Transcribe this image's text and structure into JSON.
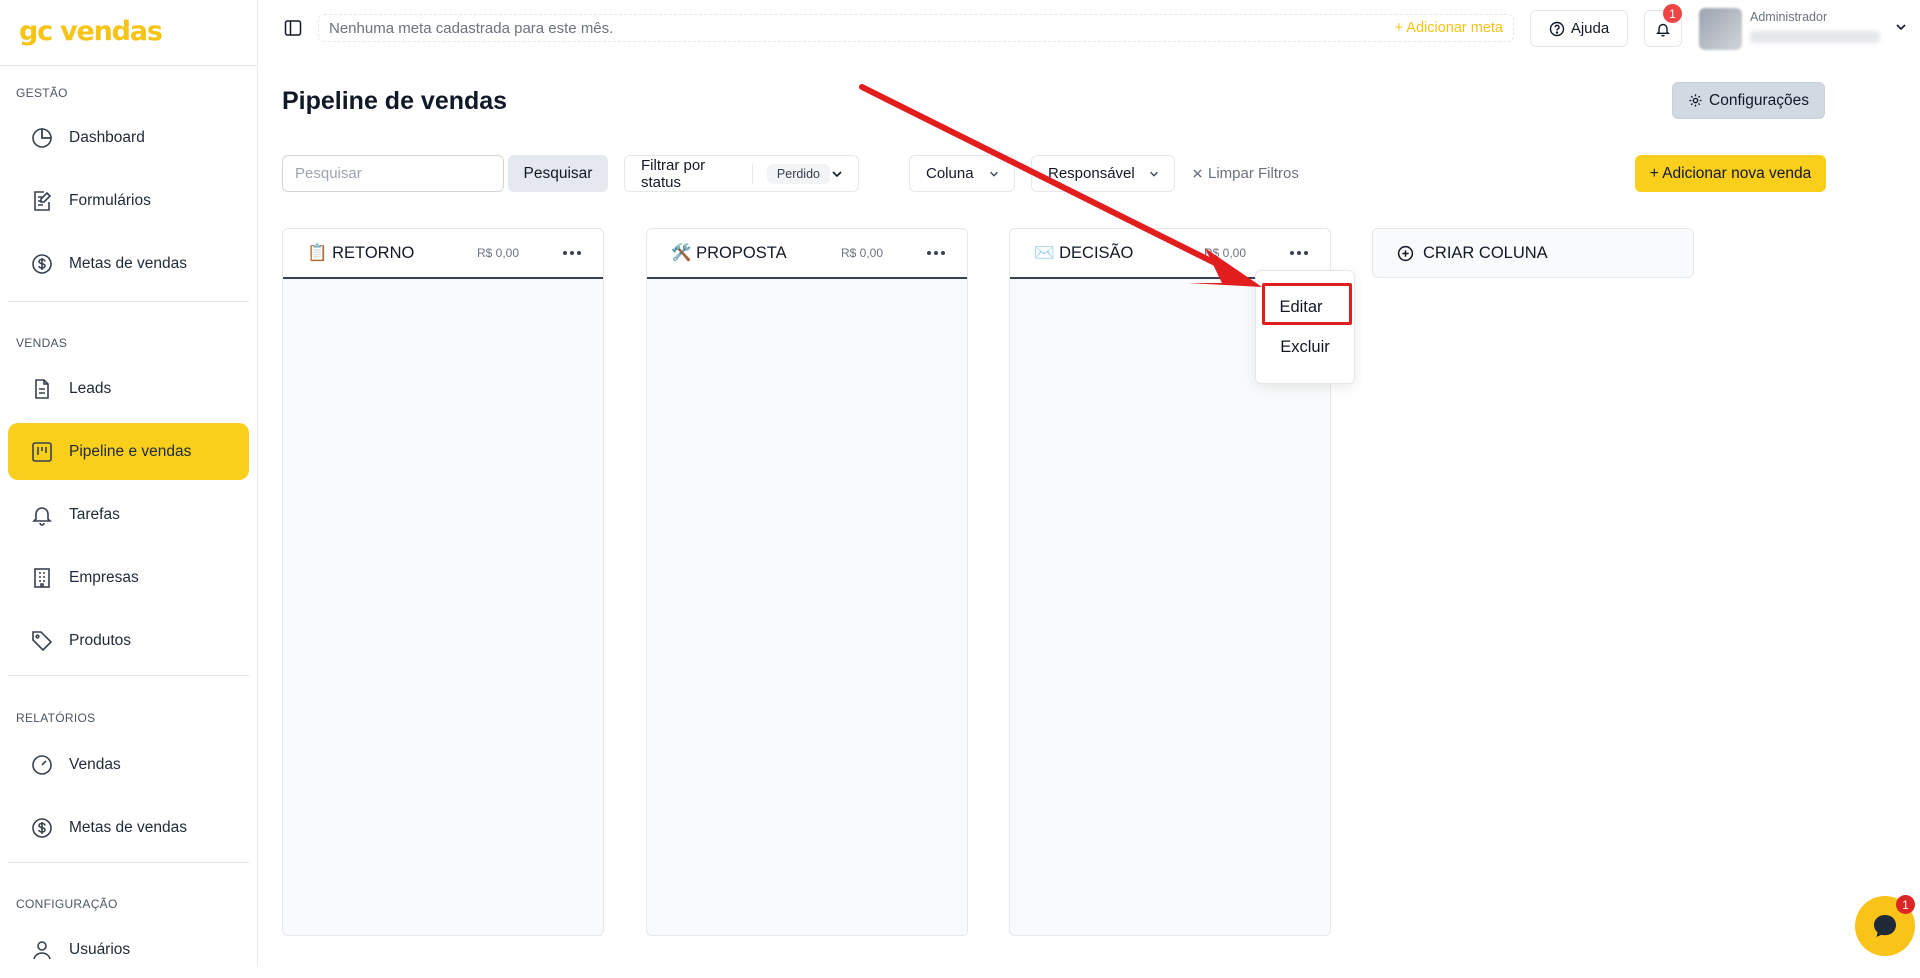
{
  "app": {
    "logo": "gc vendas"
  },
  "sidebar": {
    "sections": [
      {
        "title": "GESTÃO"
      },
      {
        "title": "VENDAS"
      },
      {
        "title": "RELATÓRIOS"
      },
      {
        "title": "CONFIGURAÇÃO"
      }
    ],
    "items": [
      {
        "label": "Dashboard",
        "icon": "pie-chart-icon"
      },
      {
        "label": "Formulários",
        "icon": "form-edit-icon"
      },
      {
        "label": "Metas de vendas",
        "icon": "dollar-circle-icon"
      },
      {
        "label": "Leads",
        "icon": "document-icon"
      },
      {
        "label": "Pipeline e vendas",
        "icon": "kanban-icon",
        "active": true
      },
      {
        "label": "Tarefas",
        "icon": "bell-icon"
      },
      {
        "label": "Empresas",
        "icon": "building-icon"
      },
      {
        "label": "Produtos",
        "icon": "tag-icon"
      },
      {
        "label": "Vendas",
        "icon": "gauge-icon"
      },
      {
        "label": "Metas de vendas",
        "icon": "dollar-circle-icon"
      },
      {
        "label": "Usuários",
        "icon": "user-icon"
      }
    ]
  },
  "topbar": {
    "goal_text": "Nenhuma meta cadastrada para este mês.",
    "add_goal": "+ Adicionar meta",
    "help_label": "Ajuda",
    "notification_count": "1",
    "user_role": "Administrador"
  },
  "main": {
    "title": "Pipeline de vendas",
    "config_label": "Configurações",
    "search_placeholder": "Pesquisar",
    "search_button": "Pesquisar",
    "status_filter_label": "Filtrar por status",
    "status_filter_value": "Perdido",
    "column_filter_label": "Coluna",
    "owner_filter_label": "Responsável",
    "clear_filters": "Limpar Filtros",
    "add_sale": "+ Adicionar nova venda",
    "create_column": "CRIAR COLUNA"
  },
  "columns": [
    {
      "title": "📋 RETORNO",
      "total": "R$ 0,00"
    },
    {
      "title": "🛠️ PROPOSTA",
      "total": "R$ 0,00"
    },
    {
      "title": "✉️ DECISÃO",
      "total": "R$ 0,00"
    }
  ],
  "column_menu": {
    "items": [
      "Editar",
      "Excluir"
    ],
    "highlighted": "Editar"
  },
  "chat": {
    "badge": "1"
  },
  "colors": {
    "accent": "#f9cf1c",
    "annotation": "#e11d1d"
  }
}
